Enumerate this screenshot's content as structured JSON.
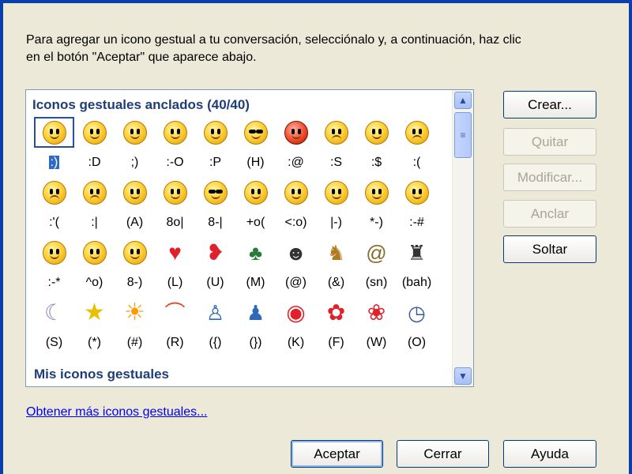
{
  "dialog": {
    "instructions": "Para agregar un icono gestual a tu conversación, selecciónalo y, a continuación, haz clic\nen el botón \"Aceptar\" que aparece abajo."
  },
  "panel": {
    "pinned_title": "Iconos gestuales anclados (40/40)",
    "my_title": "Mis iconos gestuales",
    "rows": [
      {
        "icons": [
          "smile",
          "grin",
          "wink",
          "surprised",
          "tongue",
          "cool",
          "angry",
          "confused",
          "embarrassed",
          "sad"
        ],
        "codes": [
          ":)",
          ":D",
          ";)",
          ":-O",
          ":P",
          "(H)",
          ":@",
          ":S",
          ":$",
          ":("
        ]
      },
      {
        "icons": [
          "crying",
          "disappointed",
          "angel",
          "baring-teeth",
          "nerd",
          "sick",
          "party",
          "eye-roll",
          "sarcastic",
          "secret"
        ],
        "codes": [
          ":'(",
          ":|",
          "(A)",
          "8o|",
          "8-|",
          "+o(",
          "<:o)",
          "|-)",
          "*-)",
          ":-#"
        ]
      },
      {
        "icons": [
          "dont-tell",
          "thinking",
          "eye-roll-2",
          "heart",
          "broken-heart",
          "messenger",
          "cat",
          "dog",
          "snail",
          "sheep"
        ],
        "codes": [
          ":-*",
          "^o)",
          "8-)",
          "(L)",
          "(U)",
          "(M)",
          "(@)",
          "(&)",
          "(sn)",
          "(bah)"
        ]
      },
      {
        "icons": [
          "moon",
          "star",
          "sun",
          "rainbow",
          "left-hug",
          "right-hug",
          "lips",
          "rose",
          "wilted-rose",
          "clock"
        ],
        "codes": [
          "(S)",
          "(*)",
          "(#)",
          "(R)",
          "({)",
          "(})",
          "(K)",
          "(F)",
          "(W)",
          "(O)"
        ]
      }
    ],
    "selected_index": 0
  },
  "buttons": {
    "create": "Crear...",
    "remove": "Quitar",
    "modify": "Modificar...",
    "pin": "Anclar",
    "unpin": "Soltar",
    "ok": "Aceptar",
    "close": "Cerrar",
    "help": "Ayuda"
  },
  "link": {
    "more": "Obtener más iconos gestuales..."
  },
  "scrollbar": {
    "up": "▲",
    "down": "▼",
    "grip": "≡"
  }
}
